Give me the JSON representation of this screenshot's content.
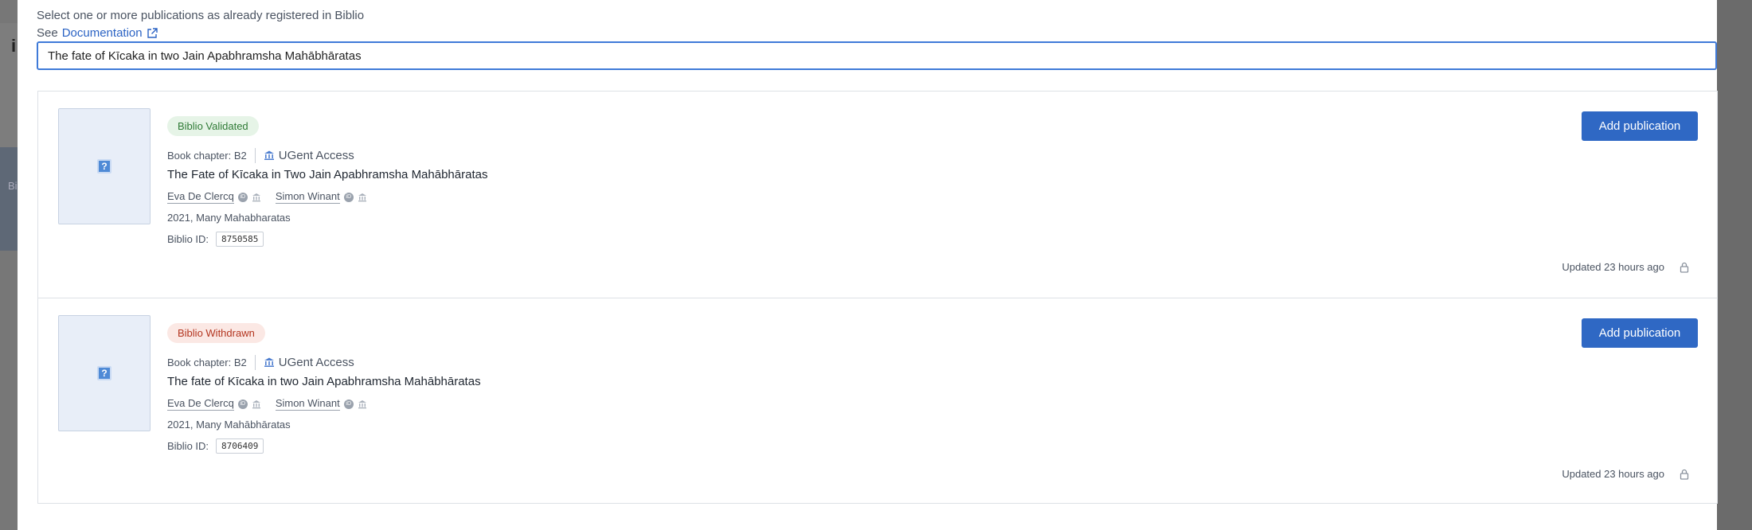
{
  "background": {
    "logo_glyph": "i",
    "side_glyph": "Bi"
  },
  "intro": {
    "text": "Select one or more publications as already registered in Biblio",
    "see_label": "See",
    "doc_link": "Documentation"
  },
  "search": {
    "value": "The fate of Kīcaka in two Jain Apabhramsha Mahābhāratas"
  },
  "results": [
    {
      "status": "Biblio Validated",
      "status_kind": "validated",
      "type": "Book chapter: B2",
      "access": "UGent Access",
      "title": "The Fate of Kīcaka in Two Jain Apabhramsha Mahābhāratas",
      "authors": [
        "Eva De Clercq",
        "Simon Winant"
      ],
      "year_source": "2021, Many Mahabharatas",
      "biblio_id_label": "Biblio ID:",
      "biblio_id": "8750585",
      "button": "Add publication",
      "updated": "Updated 23 hours ago"
    },
    {
      "status": "Biblio Withdrawn",
      "status_kind": "withdrawn",
      "type": "Book chapter: B2",
      "access": "UGent Access",
      "title": "The fate of Kīcaka in two Jain Apabhramsha Mahābhāratas",
      "authors": [
        "Eva De Clercq",
        "Simon Winant"
      ],
      "year_source": "2021, Many Mahābhāratas",
      "biblio_id_label": "Biblio ID:",
      "biblio_id": "8706409",
      "button": "Add publication",
      "updated": "Updated 23 hours ago"
    }
  ],
  "colors": {
    "primary": "#2f68c4",
    "validated_bg": "#e6f4e7",
    "validated_text": "#2e7a35",
    "withdrawn_bg": "#fbe8e4",
    "withdrawn_text": "#b3341e"
  },
  "icons": [
    "external-link-icon",
    "bank-icon",
    "orcid-icon",
    "institution-icon",
    "lock-icon",
    "question-icon"
  ]
}
